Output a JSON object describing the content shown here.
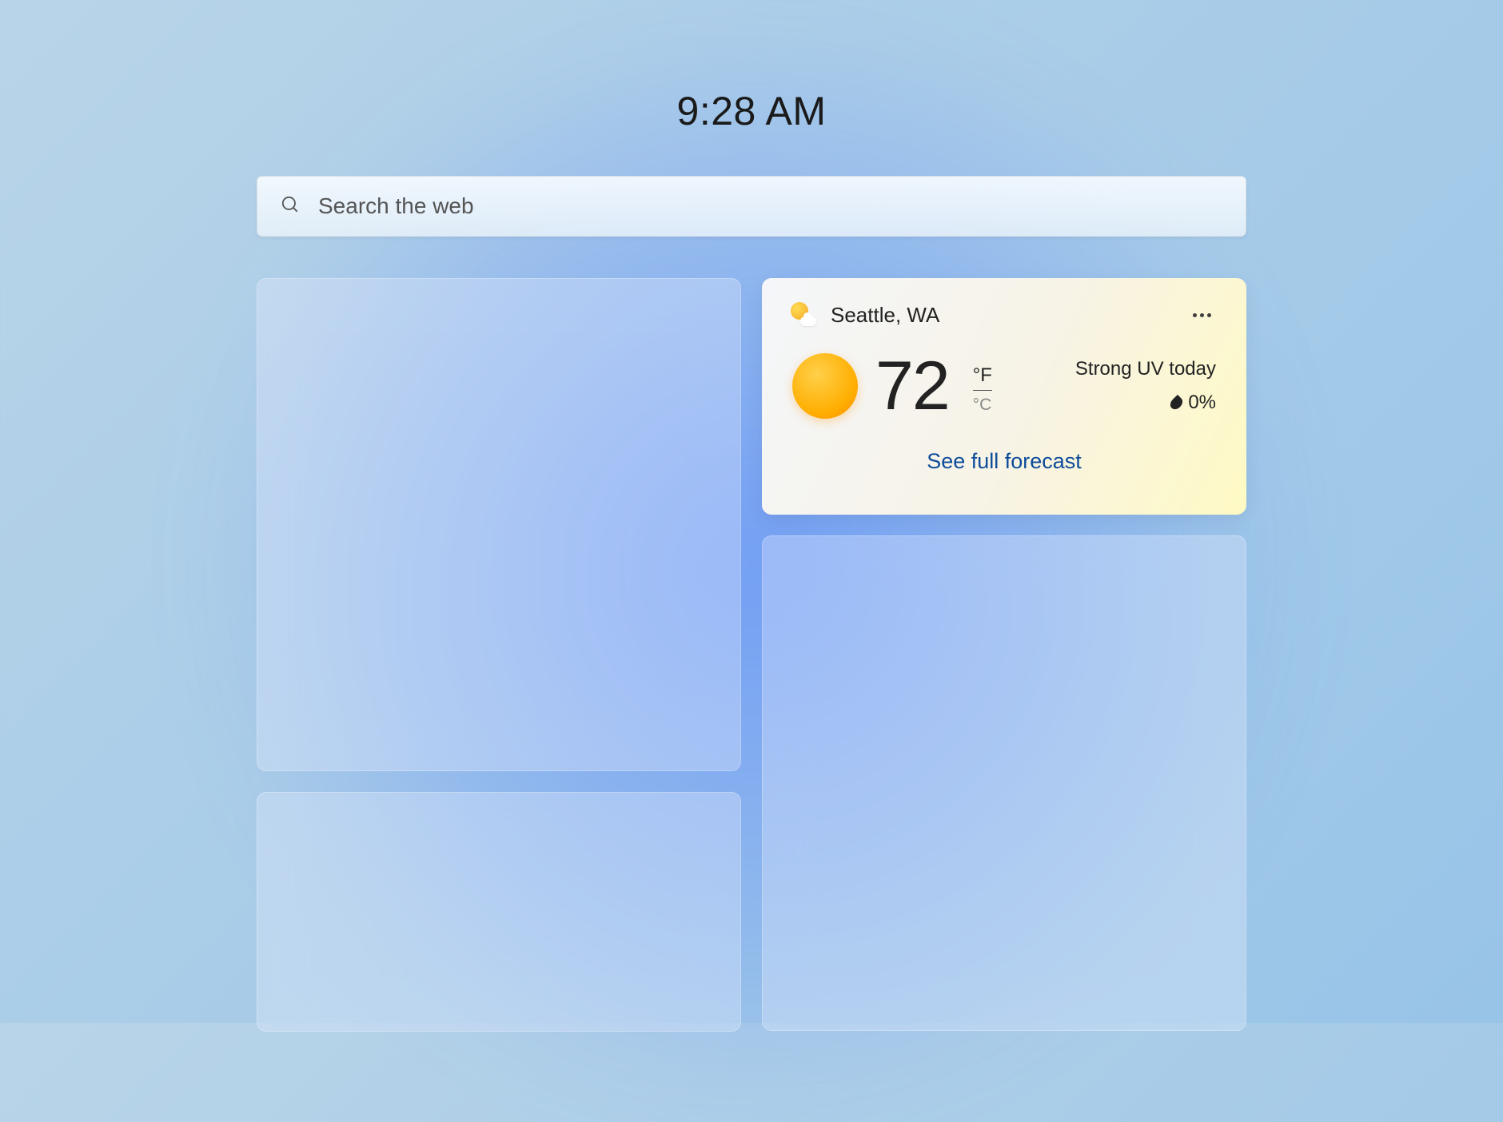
{
  "clock": {
    "time": "9:28 AM"
  },
  "search": {
    "placeholder": "Search the web"
  },
  "weather": {
    "location": "Seattle, WA",
    "temperature": "72",
    "unit_f": "°F",
    "unit_c": "°C",
    "condition": "Strong UV today",
    "precipitation": "0%",
    "forecast_link": "See full forecast"
  }
}
